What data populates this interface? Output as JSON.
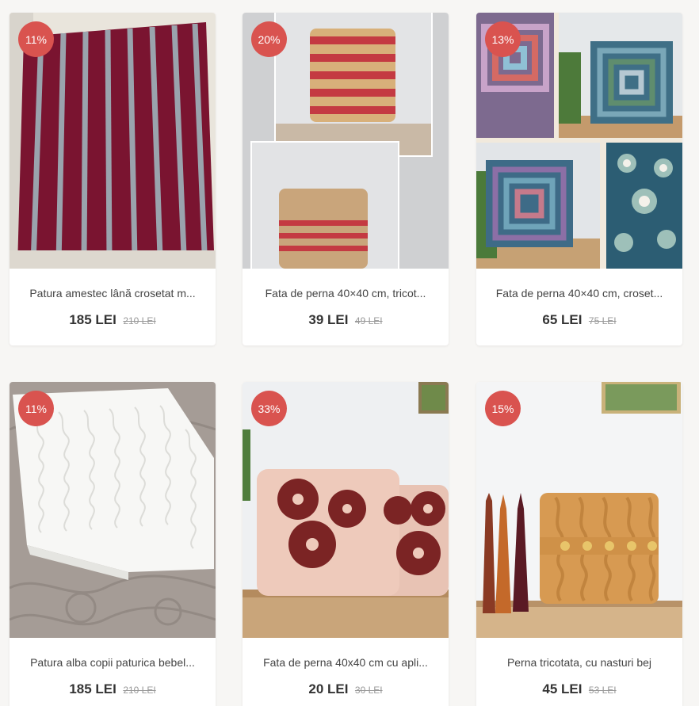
{
  "colors": {
    "badge": "#d9534f",
    "background": "#f7f6f4"
  },
  "products": [
    {
      "discount": "11%",
      "title": "Patura amestec lână crosetat m...",
      "price": "185 LEI",
      "old_price": "210 LEI",
      "image": "striped-crochet-blanket-photo"
    },
    {
      "discount": "20%",
      "title": "Fata de perna 40×40 cm, tricot...",
      "price": "39 LEI",
      "old_price": "49 LEI",
      "image": "striped-knit-pillow-photo"
    },
    {
      "discount": "13%",
      "title": "Fata de perna 40×40 cm, croset...",
      "price": "65 LEI",
      "old_price": "75 LEI",
      "image": "granny-square-pillow-photo"
    },
    {
      "discount": "11%",
      "title": "Patura alba copii paturica bebel...",
      "price": "185 LEI",
      "old_price": "210 LEI",
      "image": "white-baby-blanket-photo"
    },
    {
      "discount": "33%",
      "title": "Fata de perna 40x40 cm cu apli...",
      "price": "20 LEI",
      "old_price": "30 LEI",
      "image": "flower-applique-pillow-photo"
    },
    {
      "discount": "15%",
      "title": "Perna tricotata, cu nasturi bej",
      "price": "45 LEI",
      "old_price": "53 LEI",
      "image": "cable-knit-button-pillow-photo"
    }
  ]
}
